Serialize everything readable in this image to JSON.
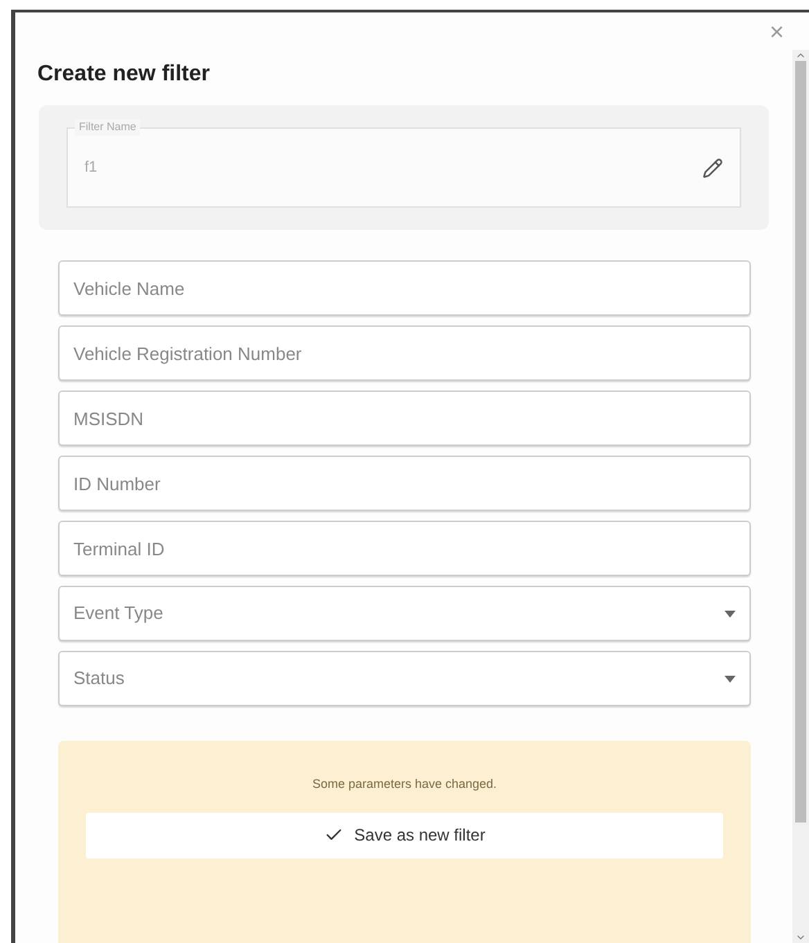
{
  "dialog": {
    "title": "Create new filter",
    "close": "×"
  },
  "filter_name": {
    "label": "Filter Name",
    "value": "f1"
  },
  "fields": [
    {
      "kind": "text",
      "placeholder": "Vehicle Name"
    },
    {
      "kind": "text",
      "placeholder": "Vehicle Registration Number"
    },
    {
      "kind": "text",
      "placeholder": "MSISDN"
    },
    {
      "kind": "text",
      "placeholder": "ID Number"
    },
    {
      "kind": "text",
      "placeholder": "Terminal ID"
    },
    {
      "kind": "select",
      "placeholder": "Event Type"
    },
    {
      "kind": "select",
      "placeholder": "Status"
    }
  ],
  "notice": {
    "message": "Some parameters have changed.",
    "button": "Save as new filter"
  }
}
